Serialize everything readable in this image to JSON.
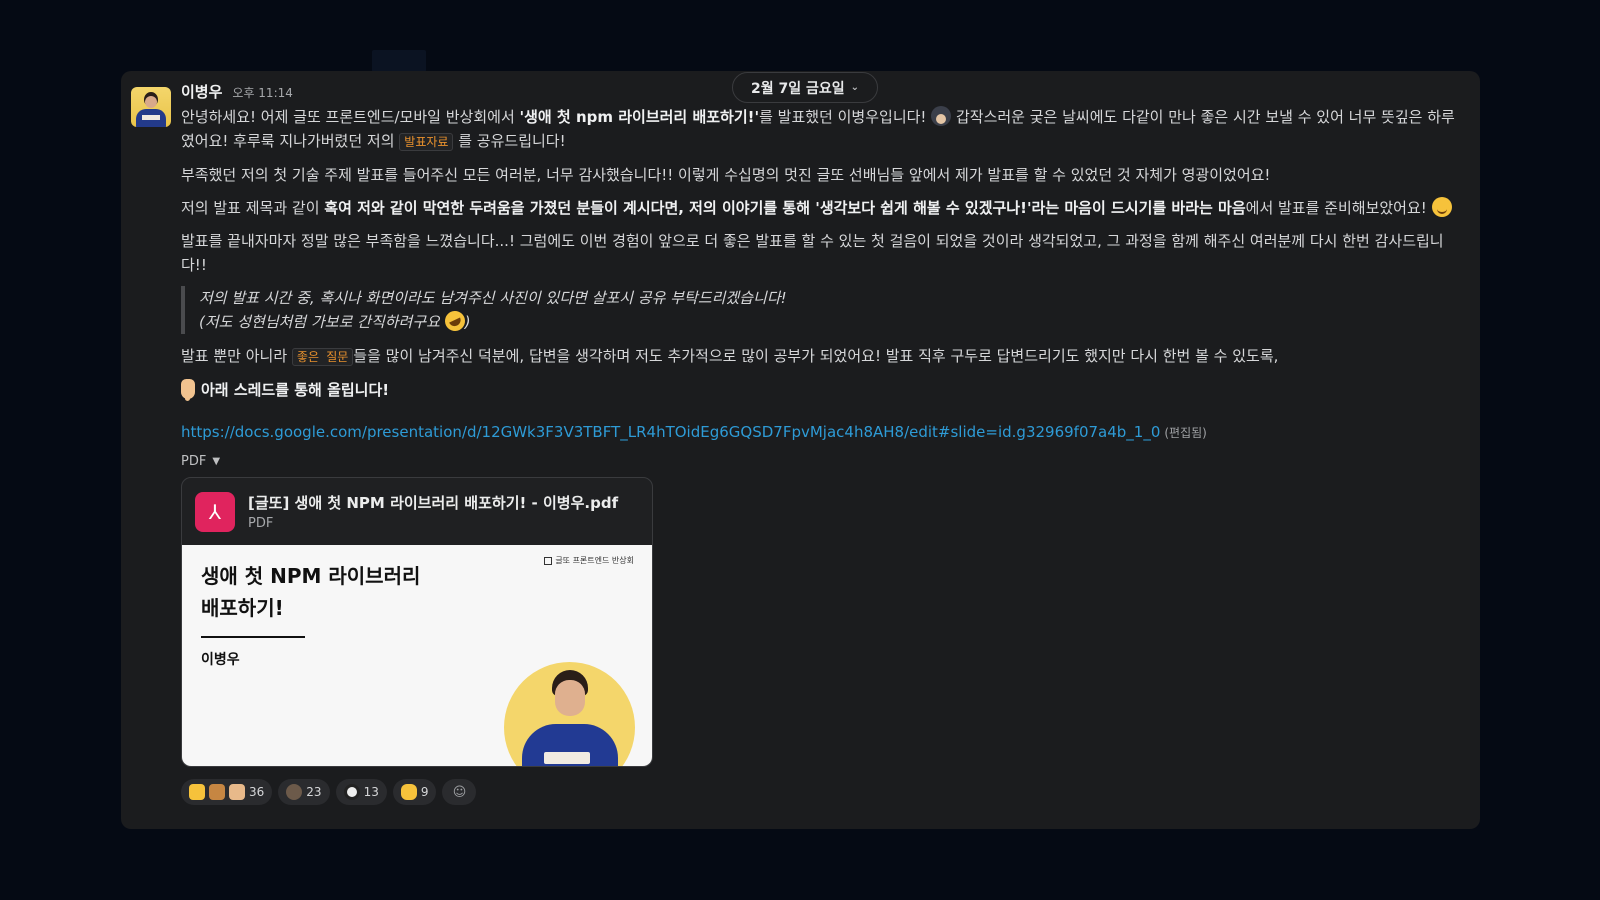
{
  "date_divider": {
    "label": "2월 7일 금요일"
  },
  "message": {
    "author": "이병우",
    "timestamp": "오후 11:14",
    "p1": {
      "before": "안녕하세요! 어제 글또 프론트엔드/모바일 반상회에서 ",
      "bold": "'생애 첫 npm 라이브러리 배포하기!'",
      "after": "를 발표했던 이병우입니다! ",
      "after2": " 갑작스러운 궂은 날씨에도 다같이 만나 좋은 시간 보낼 수 있어 너무 뜻깊은 하루였어요! 후루룩 지나가버렸던 저의 ",
      "code": "발표자료",
      "end": " 를 공유드립니다!"
    },
    "p2": "부족했던 저의 첫 기술 주제 발표를 들어주신 모든 여러분, 너무 감사했습니다!! 이렇게 수십명의 멋진 글또 선배님들 앞에서 제가 발표를 할 수 있었던 것 자체가 영광이었어요!",
    "p3": {
      "before": "저의 발표 제목과 같이 ",
      "bold": "혹여 저와 같이 막연한 두려움을 가졌던 분들이 계시다면, 저의 이야기를 통해 '생각보다 쉽게 해볼 수 있겠구나!'라는 마음이 드시기를 바라는 마음",
      "after": "에서 발표를 준비해보았어요! "
    },
    "p4": "발표를 끝내자마자 정말 많은 부족함을 느꼈습니다...! 그럼에도 이번 경험이 앞으로 더 좋은 발표를 할 수 있는 첫 걸음이 되었을 것이라 생각되었고, 그 과정을 함께 해주신 여러분께 다시 한번 감사드립니다!!",
    "quote": {
      "line1": "저의 발표 시간 중, 혹시나 화면이라도 남겨주신 사진이 있다면 살포시 공유 부탁드리겠습니다!",
      "line2": "(저도 성현님처럼 가보로 간직하려구요 ",
      "line2_end": ")"
    },
    "p5": {
      "before": "발표 뿐만 아니라 ",
      "code": "좋은 질문",
      "after": "들을 많이 남겨주신 덕분에, 답변을 생각하며 저도 추가적으로 많이 공부가 되었어요! 발표 직후 구두로 답변드리기도 했지만 다시 한번 볼 수 있도록,"
    },
    "p6": "아래 스레드를 통해 올립니다!",
    "link": "https://docs.google.com/presentation/d/12GWk3F3V3TBFT_LR4hTOidEg6GQSD7FpvMjac4h8AH8/edit#slide=id.g32969f07a4b_1_0",
    "edited": "(편집됨)"
  },
  "attachment": {
    "toggle_label": "PDF",
    "file_name": "[글또] 생애 첫 NPM 라이브러리 배포하기! - 이병우.pdf",
    "file_type": "PDF",
    "pdf_icon": "pdf-icon",
    "slide": {
      "title_line1": "생애 첫 NPM 라이브러리",
      "title_line2": "배포하기!",
      "author": "이병우",
      "logo_text": "글또 프론트엔드 반상회"
    }
  },
  "reactions": [
    {
      "icon": "thumbs-up-multi-icon",
      "count": "36"
    },
    {
      "icon": "face-emoji-icon",
      "count": "23"
    },
    {
      "icon": "soccer-ball-icon",
      "count": "13"
    },
    {
      "icon": "raised-hands-icon",
      "count": "9"
    }
  ],
  "colors": {
    "background": "#050a14",
    "panel": "#1b1c1e",
    "link": "#2e9bd6",
    "code": "#e8912d",
    "pdf_icon": "#e0245e"
  }
}
